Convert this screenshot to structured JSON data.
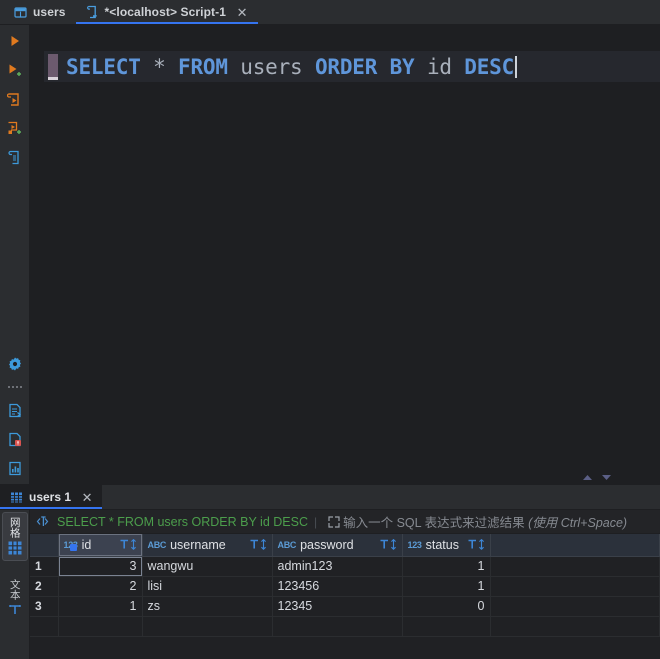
{
  "window": {
    "editor_tabs": [
      {
        "label": "users",
        "icon": "table-icon",
        "active": false,
        "closable": false
      },
      {
        "label": "*<localhost> Script-1",
        "icon": "script-icon",
        "active": true,
        "closable": true
      }
    ]
  },
  "toolbar": {
    "items": [
      {
        "name": "execute-button",
        "icon": "play-icon",
        "color": "#e07a1f"
      },
      {
        "name": "execute-new-button",
        "icon": "play-plus-icon",
        "color": "#e07a1f"
      },
      {
        "name": "run-script-button",
        "icon": "run-script-icon",
        "color": "#e07a1f"
      },
      {
        "name": "run-script-new-button",
        "icon": "run-script-plus-icon",
        "color": "#e07a1f"
      },
      {
        "name": "explain-plan-button",
        "icon": "document-plan-icon",
        "color": "#3d9adb"
      }
    ],
    "bottom_items": [
      {
        "name": "settings-button",
        "icon": "gear-icon",
        "color": "#3d9adb"
      },
      {
        "name": "export-data-button",
        "icon": "export-document-icon",
        "color": "#3d9adb"
      },
      {
        "name": "document-error-button",
        "icon": "document-error-icon",
        "color": "#3d9adb"
      },
      {
        "name": "document-chart-button",
        "icon": "document-chart-icon",
        "color": "#3d9adb"
      }
    ]
  },
  "editor": {
    "query_tokens": [
      {
        "text": "SELECT",
        "type": "keyword"
      },
      {
        "text": " ",
        "type": "plain"
      },
      {
        "text": "*",
        "type": "operator"
      },
      {
        "text": " ",
        "type": "plain"
      },
      {
        "text": "FROM",
        "type": "keyword"
      },
      {
        "text": " ",
        "type": "plain"
      },
      {
        "text": "users",
        "type": "identifier"
      },
      {
        "text": " ",
        "type": "plain"
      },
      {
        "text": "ORDER",
        "type": "keyword"
      },
      {
        "text": " ",
        "type": "plain"
      },
      {
        "text": "BY",
        "type": "keyword"
      },
      {
        "text": " ",
        "type": "plain"
      },
      {
        "text": "id",
        "type": "identifier"
      },
      {
        "text": " ",
        "type": "plain"
      },
      {
        "text": "DESC",
        "type": "keyword"
      }
    ],
    "query_plain": "SELECT * FROM users ORDER BY id DESC"
  },
  "results": {
    "tab": {
      "label": "users 1",
      "icon": "grid-table-icon"
    },
    "filter_bar": {
      "executed_sql": "SELECT * FROM users ORDER BY id DESC",
      "type_icon": "angle-T-icon",
      "expand_icon": "expand-arrows-icon",
      "placeholder": "输入一个 SQL 表达式来过滤结果",
      "placeholder_hint": "(使用 Ctrl+Space)"
    },
    "view_tabs": [
      {
        "label": "网格",
        "icon": "grid-icon",
        "selected": true
      },
      {
        "label": "文本",
        "icon": "text-T-icon",
        "selected": false
      }
    ],
    "columns": [
      {
        "name": "id",
        "type_icon": "123",
        "primary_key": true
      },
      {
        "name": "username",
        "type_icon": "ABC",
        "primary_key": false
      },
      {
        "name": "password",
        "type_icon": "ABC",
        "primary_key": false
      },
      {
        "name": "status",
        "type_icon": "123",
        "primary_key": false
      }
    ],
    "rows": [
      {
        "num": "1",
        "id": "3",
        "username": "wangwu",
        "password": "admin123",
        "status": "1"
      },
      {
        "num": "2",
        "id": "2",
        "username": "lisi",
        "password": "123456",
        "status": "1"
      },
      {
        "num": "3",
        "id": "1",
        "username": "zs",
        "password": "12345",
        "status": "0"
      }
    ],
    "selected_cell": {
      "row": 0,
      "column": "id"
    }
  },
  "colors": {
    "accent": "#3574f0",
    "keyword": "#5f96da",
    "identifier": "#a9b0bb",
    "filter_sql_green": "#4c9e4c",
    "orange_icon": "#e07a1f",
    "blue_icon": "#3d9adb",
    "header_bg": "#2b313b",
    "row_bg": "#202124",
    "panel_bg": "#2b2d30",
    "editor_bg": "#1e1f22"
  }
}
